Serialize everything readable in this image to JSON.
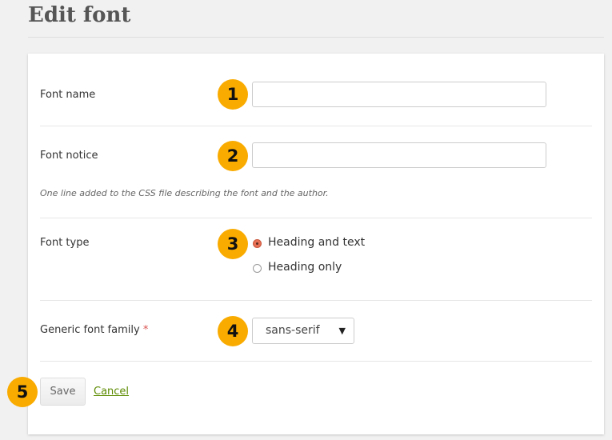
{
  "page": {
    "title": "Edit font"
  },
  "form": {
    "font_name": {
      "label": "Font name",
      "value": "",
      "badge": "1"
    },
    "font_notice": {
      "label": "Font notice",
      "value": "",
      "badge": "2",
      "help": "One line added to the CSS file describing the font and the author."
    },
    "font_type": {
      "label": "Font type",
      "badge": "3",
      "options": [
        {
          "label": "Heading and text",
          "selected": true
        },
        {
          "label": "Heading only",
          "selected": false
        }
      ]
    },
    "generic_family": {
      "label": "Generic font family",
      "required_mark": "*",
      "value": "sans-serif",
      "badge": "4"
    },
    "save_label": "Save",
    "cancel_label": "Cancel",
    "actions_badge": "5"
  },
  "colors": {
    "badge": "#f9ab00",
    "link": "#5c8a00",
    "radio_selected": "#e77055"
  }
}
